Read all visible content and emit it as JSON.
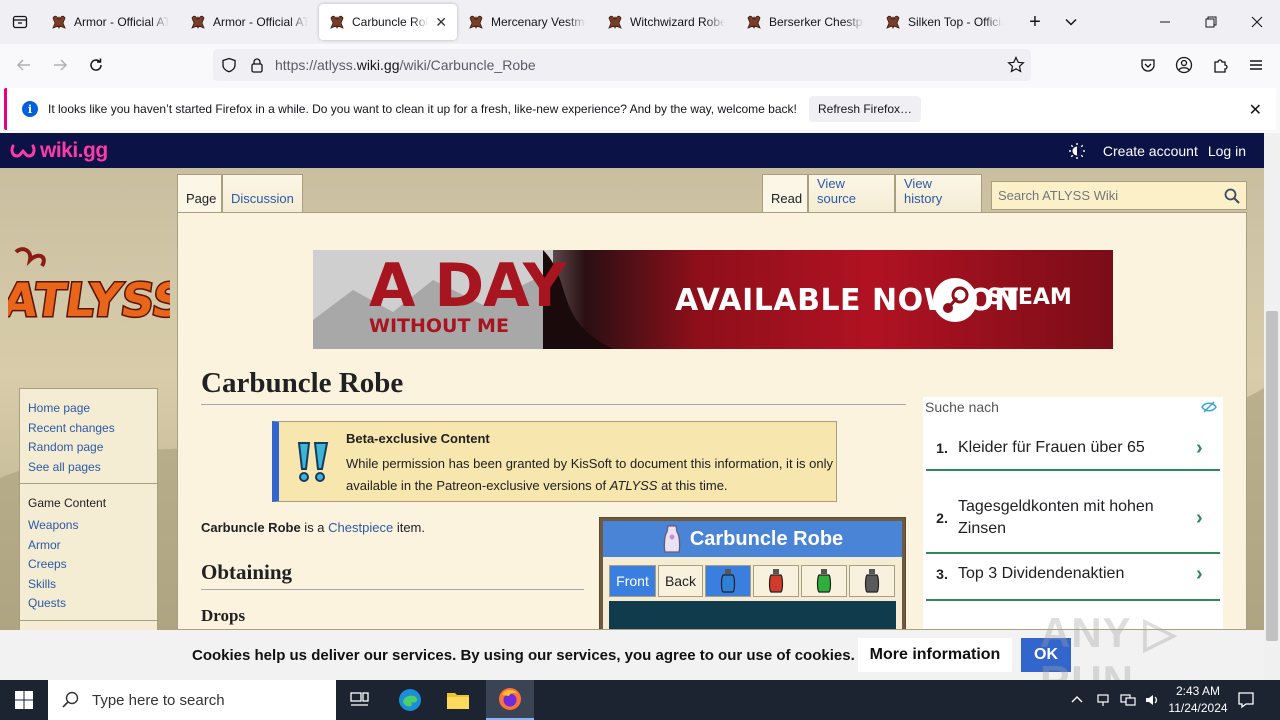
{
  "browser": {
    "tabs": [
      {
        "title": "Armor - Official ATLYSS Wiki",
        "active": false
      },
      {
        "title": "Armor - Official ATLYSS Wiki",
        "active": false
      },
      {
        "title": "Carbuncle Robe - Official ATLYSS Wiki",
        "active": true
      },
      {
        "title": "Mercenary Vestment - Official ATLYSS Wiki",
        "active": false
      },
      {
        "title": "Witchwizard Robe - Official ATLYSS Wiki",
        "active": false
      },
      {
        "title": "Berserker Chestpiece - Official ATLYSS Wiki",
        "active": false
      },
      {
        "title": "Silken Top - Official ATLYSS Wiki",
        "active": false
      }
    ],
    "new_tab": "+",
    "url_prefix": "https://atlyss.",
    "url_domain": "wiki.gg",
    "url_path": "/wiki/Carbuncle_Robe"
  },
  "notification": {
    "message": "It looks like you haven’t started Firefox in a while. Do you want to clean it up for a fresh, like-new experience? And by the way, welcome back!",
    "button": "Refresh Firefox…",
    "info_glyph": "i",
    "close_glyph": "✕"
  },
  "wiki_header": {
    "logo": "wiki.gg",
    "create_account": "Create account",
    "login": "Log in"
  },
  "sidebar": {
    "nav": [
      "Home page",
      "Recent changes",
      "Random page",
      "See all pages"
    ],
    "game_heading": "Game Content",
    "game_links": [
      "Weapons",
      "Armor",
      "Creeps",
      "Skills",
      "Quests"
    ]
  },
  "page_tabs": {
    "page": "Page",
    "discussion": "Discussion",
    "read": "Read",
    "view_source": "View source",
    "view_history": "View history",
    "search_placeholder": "Search ATLYSS Wiki"
  },
  "banner": {
    "line1": "A DAY",
    "line2": "WITHOUT ME",
    "available": "AVAILABLE NOW ON",
    "platform": "STEAM"
  },
  "article": {
    "title": "Carbuncle Robe",
    "beta_title": "Beta-exclusive Content",
    "beta_text_1": "While permission has been granted by KisSoft to document this information, it is only available in the Patreon-exclusive versions of ",
    "beta_text_em": "ATLYSS",
    "beta_text_2": " at this time.",
    "intro_bold": "Carbuncle Robe",
    "intro_mid": " is a ",
    "intro_link": "Chestpiece",
    "intro_end": " item.",
    "section_obtaining": "Obtaining",
    "section_drops": "Drops"
  },
  "infobox": {
    "title": "Carbuncle Robe",
    "tab_front": "Front",
    "tab_back": "Back",
    "dye_colors": [
      "#2f7fd6",
      "#d23a2a",
      "#2fae3a",
      "#5a5a5a"
    ]
  },
  "ad": {
    "header": "Suche nach",
    "items": [
      {
        "num": "1.",
        "label": "Kleider für Frauen über 65"
      },
      {
        "num": "2.",
        "label": "Tagesgeldkonten mit hohen Zinsen"
      },
      {
        "num": "3.",
        "label": "Top 3 Dividendenaktien"
      }
    ],
    "chevron": "›"
  },
  "cookie": {
    "message": "Cookies help us deliver our services. By using our services, you agree to our use of cookies.",
    "more_info": "More information",
    "ok": "OK"
  },
  "watermark": "ANY ▷ RUN",
  "taskbar": {
    "search_placeholder": "Type here to search",
    "time": "2:43 AM",
    "date": "11/24/2024"
  }
}
